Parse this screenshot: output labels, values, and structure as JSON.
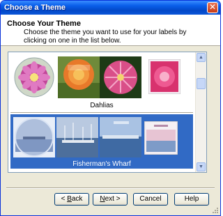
{
  "window": {
    "title": "Choose a Theme"
  },
  "header": {
    "title": "Choose Your Theme",
    "description": "Choose the theme you want to use for your labels by clicking on one in the list below."
  },
  "themes": [
    {
      "name": "Dahlias",
      "selected": false
    },
    {
      "name": "Fisherman's Wharf",
      "selected": true
    }
  ],
  "buttons": {
    "back_mnemonic": "B",
    "back_rest": "ack",
    "next_mnemonic": "N",
    "next_rest": "ext >",
    "cancel": "Cancel",
    "help": "Help"
  },
  "colors": {
    "selection": "#316ac5",
    "titlebar": "#0a5fea"
  }
}
